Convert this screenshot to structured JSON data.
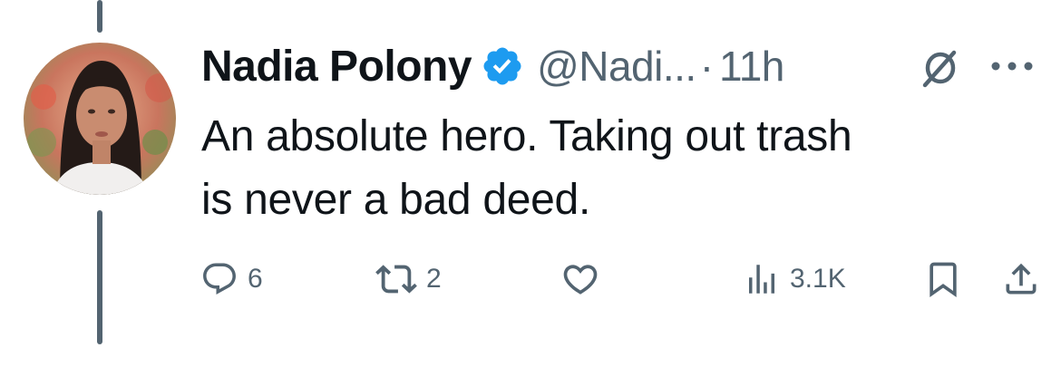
{
  "tweet": {
    "author": {
      "display_name": "Nadia Polony",
      "handle": "@Nadi...",
      "verified": true,
      "avatar_icon": "avatar-photo"
    },
    "separator": "·",
    "time": "11h",
    "text_line1": "An absolute hero. Taking out trash",
    "text_line2": "is never a bad deed.",
    "actions": {
      "reply_count": "6",
      "retweet_count": "2",
      "like_count": "",
      "views_count": "3.1K"
    },
    "icons": {
      "verified": "verified-badge-icon",
      "grok": "grok-icon",
      "more": "more-icon",
      "reply": "reply-icon",
      "retweet": "retweet-icon",
      "like": "heart-icon",
      "views": "views-icon",
      "bookmark": "bookmark-icon",
      "share": "share-icon"
    },
    "colors": {
      "text": "#0f1419",
      "secondary": "#536471",
      "verified_blue": "#1d9bf0",
      "thread_line": "#536471"
    }
  }
}
